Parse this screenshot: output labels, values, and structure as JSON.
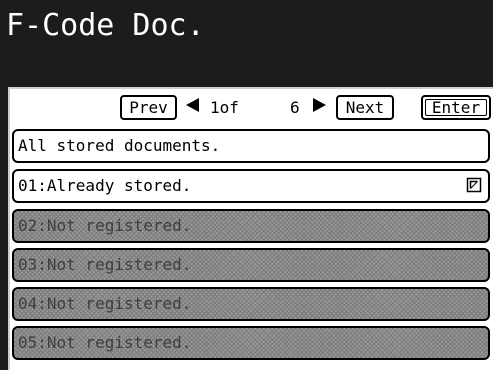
{
  "header": {
    "title": "F-Code Doc."
  },
  "nav": {
    "prev_label": "Prev",
    "page_current": "1of",
    "page_total": "6",
    "next_label": "Next",
    "enter_label": "Enter"
  },
  "items": [
    {
      "label": "All stored documents.",
      "enabled": true
    },
    {
      "label": "01:Already stored.",
      "enabled": true,
      "icon": "stored-document-icon"
    },
    {
      "label": "02:Not registered.",
      "enabled": false
    },
    {
      "label": "03:Not registered.",
      "enabled": false
    },
    {
      "label": "04:Not registered.",
      "enabled": false
    },
    {
      "label": "05:Not registered.",
      "enabled": false
    }
  ]
}
